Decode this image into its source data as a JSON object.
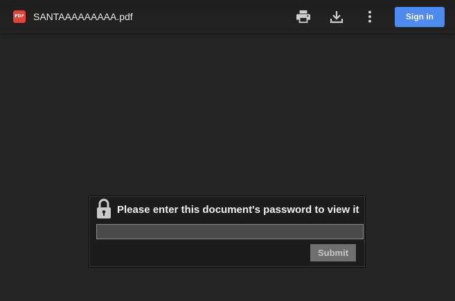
{
  "toolbar": {
    "file_badge": "PDF",
    "file_name": "SANTAAAAAAAAA.pdf",
    "print_icon": "print-icon",
    "download_icon": "download-icon",
    "more_icon": "more-vert-icon",
    "sign_in_label": "Sign in",
    "accent_color": "#4d8bf0",
    "badge_color": "#e94235"
  },
  "password_dialog": {
    "lock_icon": "lock-icon",
    "prompt": "Please enter this document's password to view it",
    "password_value": "",
    "submit_label": "Submit"
  }
}
